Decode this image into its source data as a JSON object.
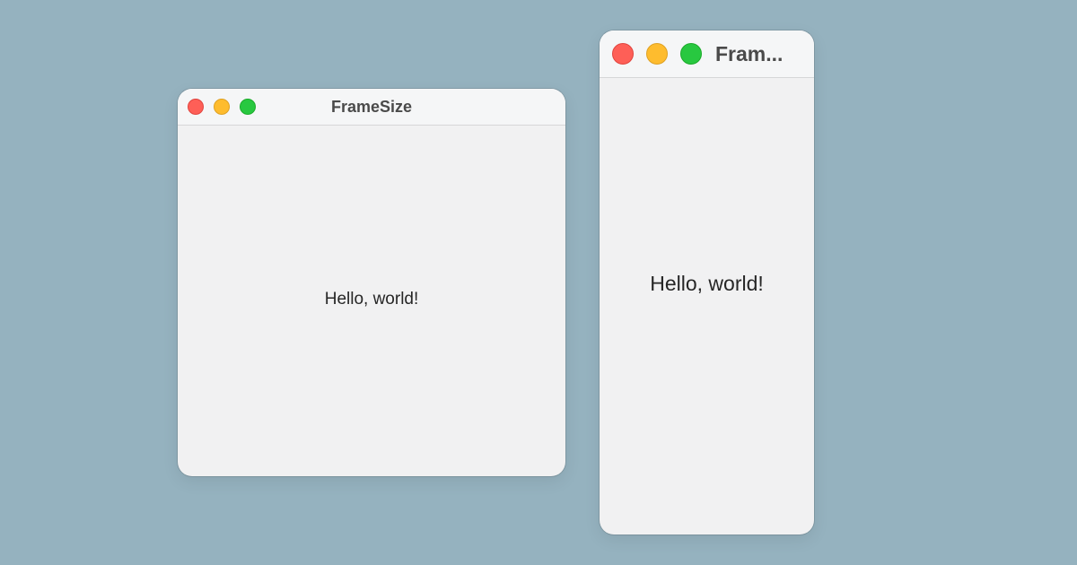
{
  "windows": [
    {
      "title": "FrameSize",
      "content_text": "Hello, world!"
    },
    {
      "title": "Fram...",
      "content_text": "Hello, world!"
    }
  ],
  "colors": {
    "desktop": "#95b2bf",
    "window_bg": "#f1f1f2",
    "close": "#fe5f57",
    "minimize": "#febc2e",
    "zoom": "#28c840"
  },
  "icons": {
    "close": "close-button-icon",
    "minimize": "minimize-button-icon",
    "zoom": "zoom-button-icon"
  }
}
